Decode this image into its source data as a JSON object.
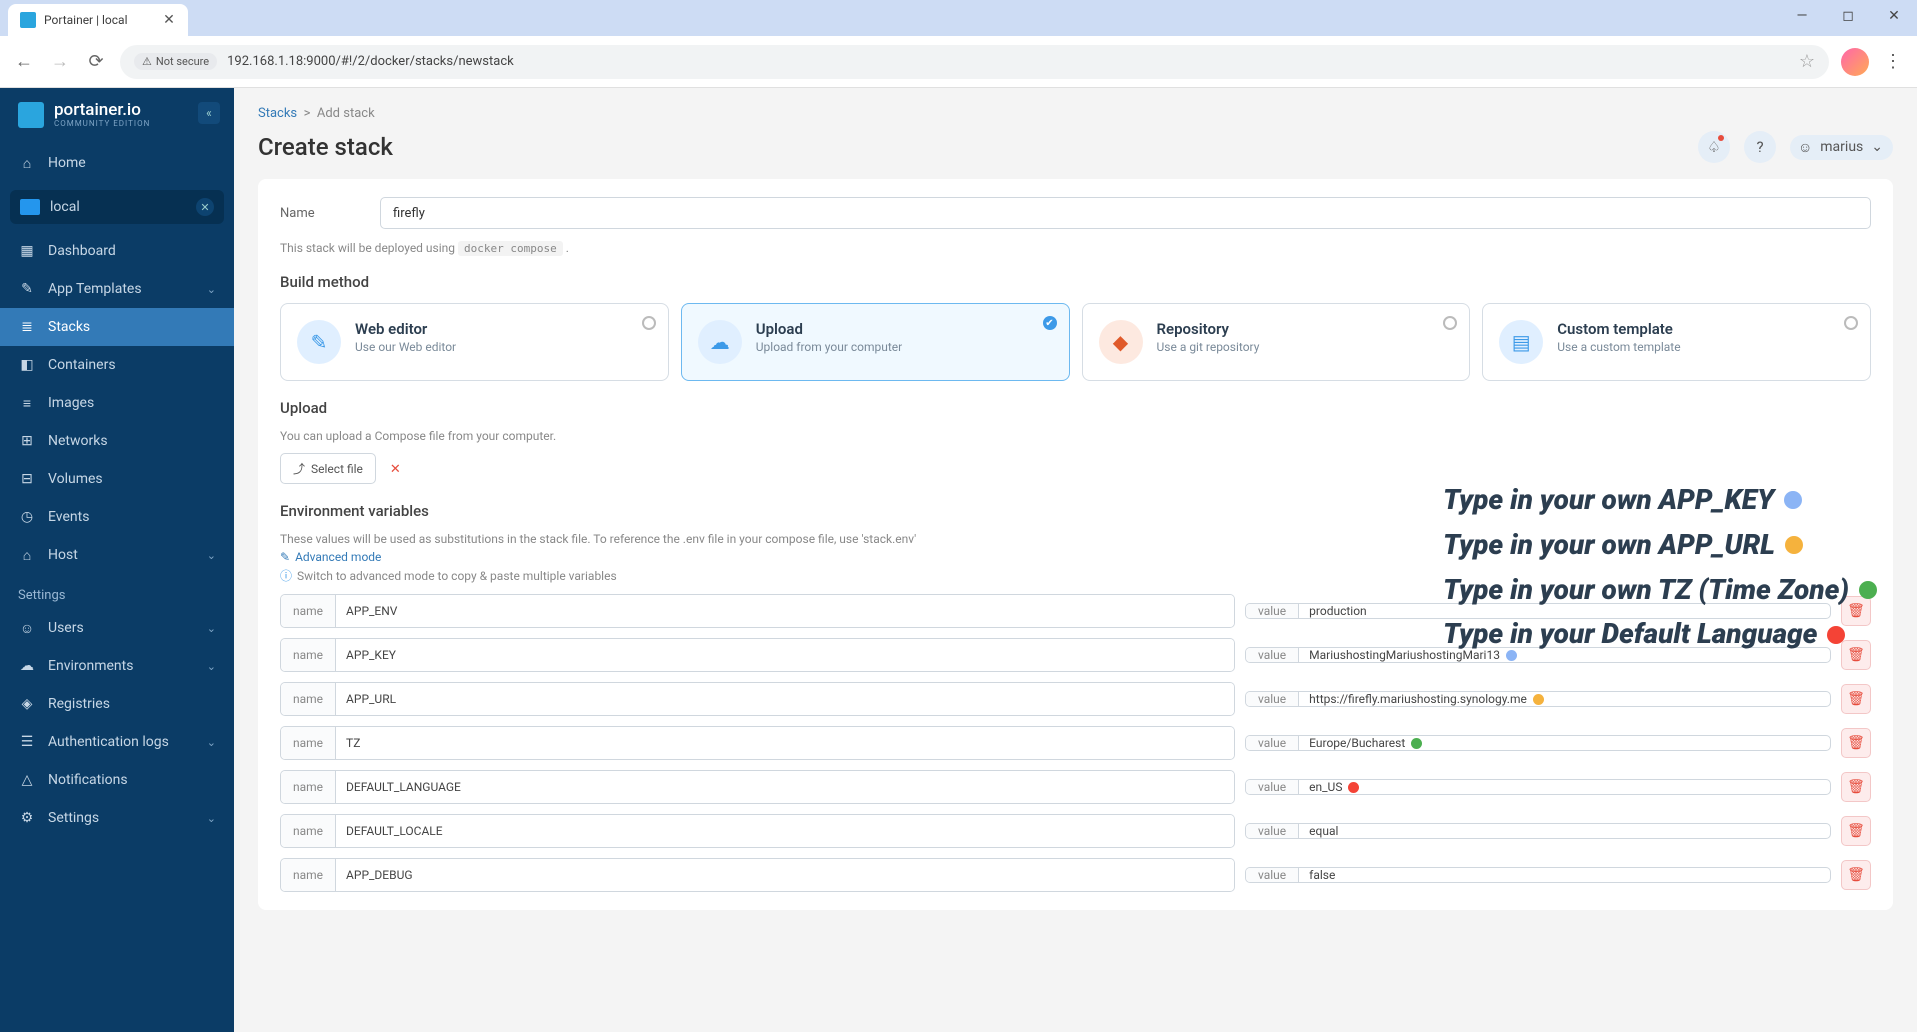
{
  "browser": {
    "tab_title": "Portainer | local",
    "security_badge": "Not secure",
    "url": "192.168.1.18:9000/#!/2/docker/stacks/newstack"
  },
  "sidebar": {
    "brand": "portainer.io",
    "brand_sub": "COMMUNITY EDITION",
    "home": "Home",
    "env_name": "local",
    "items": [
      {
        "icon": "▦",
        "label": "Dashboard",
        "chev": false
      },
      {
        "icon": "✎",
        "label": "App Templates",
        "chev": true
      },
      {
        "icon": "≣",
        "label": "Stacks",
        "chev": false,
        "active": true
      },
      {
        "icon": "◧",
        "label": "Containers",
        "chev": false
      },
      {
        "icon": "≡",
        "label": "Images",
        "chev": false
      },
      {
        "icon": "⊞",
        "label": "Networks",
        "chev": false
      },
      {
        "icon": "⊟",
        "label": "Volumes",
        "chev": false
      },
      {
        "icon": "◷",
        "label": "Events",
        "chev": false
      },
      {
        "icon": "⌂",
        "label": "Host",
        "chev": true
      }
    ],
    "settings_header": "Settings",
    "settings": [
      {
        "icon": "☺",
        "label": "Users",
        "chev": true
      },
      {
        "icon": "☁",
        "label": "Environments",
        "chev": true
      },
      {
        "icon": "◈",
        "label": "Registries",
        "chev": false
      },
      {
        "icon": "☰",
        "label": "Authentication logs",
        "chev": true
      },
      {
        "icon": "△",
        "label": "Notifications",
        "chev": false
      },
      {
        "icon": "⚙",
        "label": "Settings",
        "chev": true
      }
    ]
  },
  "breadcrumb": {
    "root": "Stacks",
    "sep": ">",
    "leaf": "Add stack"
  },
  "page_title": "Create stack",
  "user": "marius",
  "form": {
    "name_label": "Name",
    "name_value": "firefly",
    "deploy_hint_pre": "This stack will be deployed using",
    "deploy_hint_code": "docker compose",
    "build_method_title": "Build method",
    "methods": [
      {
        "title": "Web editor",
        "sub": "Use our Web editor"
      },
      {
        "title": "Upload",
        "sub": "Upload from your computer",
        "selected": true
      },
      {
        "title": "Repository",
        "sub": "Use a git repository"
      },
      {
        "title": "Custom template",
        "sub": "Use a custom template"
      }
    ],
    "upload_title": "Upload",
    "upload_hint": "You can upload a Compose file from your computer.",
    "select_file": "Select file",
    "env_title": "Environment variables",
    "env_hint": "These values will be used as substitutions in the stack file. To reference the .env file in your compose file, use 'stack.env'",
    "adv_mode": "Advanced mode",
    "adv_note": "Switch to advanced mode to copy & paste multiple variables",
    "name_col": "name",
    "value_col": "value",
    "env_rows": [
      {
        "name": "APP_ENV",
        "value": "production",
        "marker": null
      },
      {
        "name": "APP_KEY",
        "value": "MariushostingMariushostingMari13",
        "marker": "mk-blue"
      },
      {
        "name": "APP_URL",
        "value": "https://firefly.mariushosting.synology.me",
        "marker": "mk-orange"
      },
      {
        "name": "TZ",
        "value": "Europe/Bucharest",
        "marker": "mk-green"
      },
      {
        "name": "DEFAULT_LANGUAGE",
        "value": "en_US",
        "marker": "mk-red"
      },
      {
        "name": "DEFAULT_LOCALE",
        "value": "equal",
        "marker": null
      },
      {
        "name": "APP_DEBUG",
        "value": "false",
        "marker": null
      }
    ]
  },
  "overlay": [
    {
      "text": "Type in your own  APP_KEY",
      "dot": "#8bb4f5"
    },
    {
      "text": "Type in your own APP_URL",
      "dot": "#f5b23d"
    },
    {
      "text": "Type in your own TZ (Time Zone)",
      "dot": "#4caf50"
    },
    {
      "text": "Type in your Default Language",
      "dot": "#f44336"
    }
  ]
}
